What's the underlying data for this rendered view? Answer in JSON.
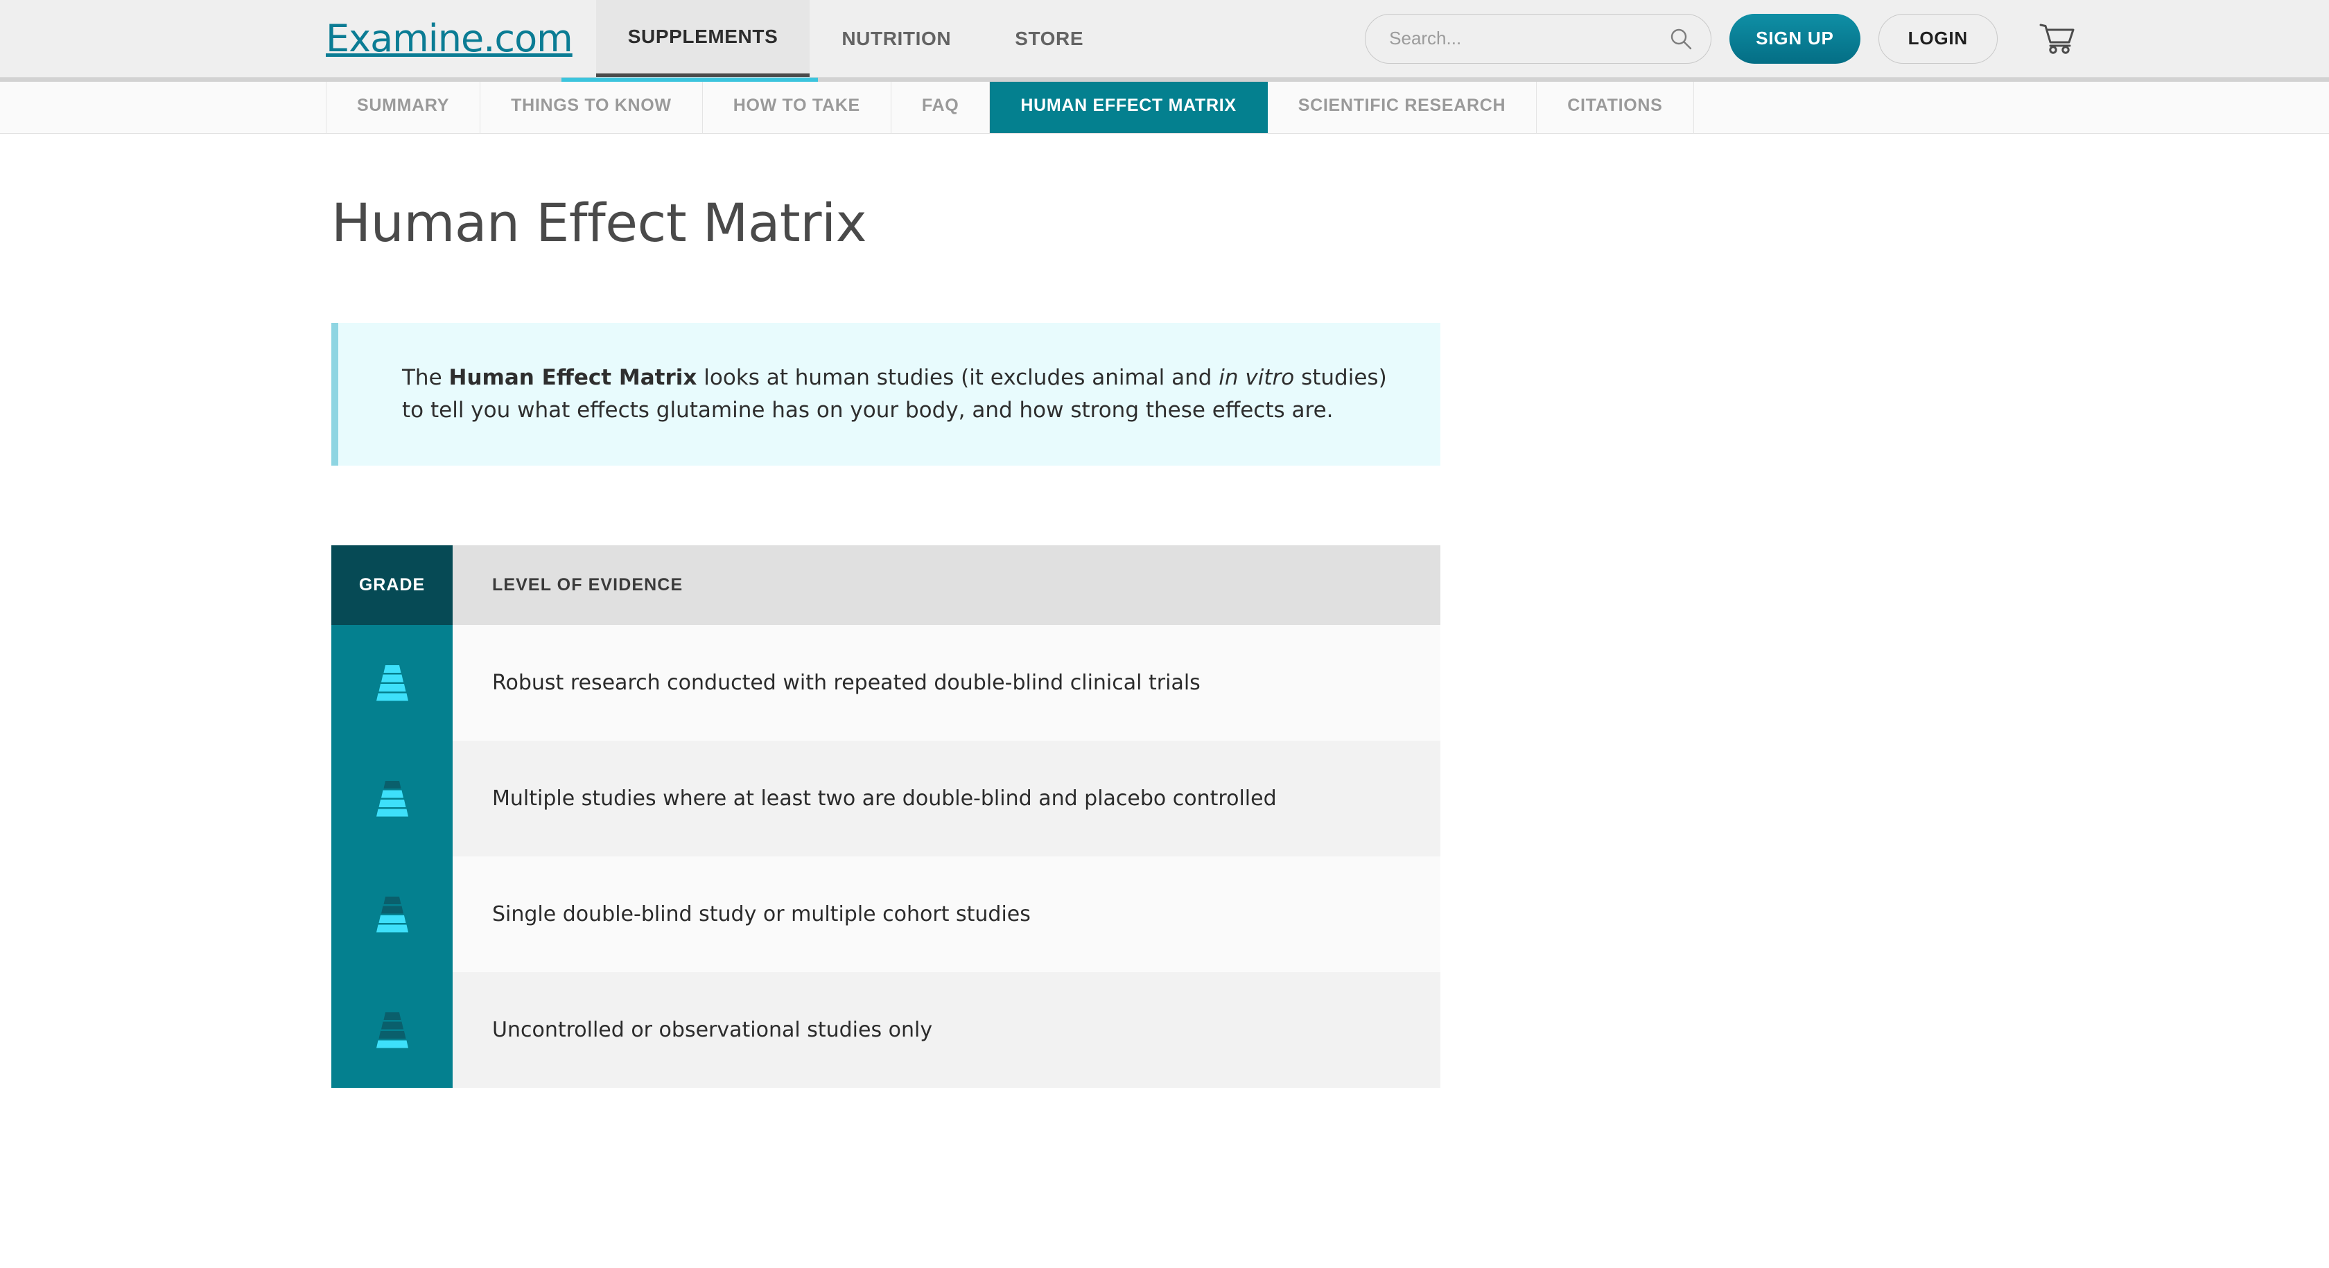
{
  "header": {
    "logo_text": "Examine.com",
    "nav": [
      {
        "label": "SUPPLEMENTS",
        "active": true
      },
      {
        "label": "NUTRITION",
        "active": false
      },
      {
        "label": "STORE",
        "active": false
      }
    ],
    "search": {
      "placeholder": "Search...",
      "value": "",
      "icon": "search-icon"
    },
    "signup_label": "SIGN UP",
    "login_label": "LOGIN",
    "cart_icon": "shopping-cart-icon",
    "accent_color": "#04808f"
  },
  "tabs": [
    {
      "label": "SUMMARY",
      "active": false
    },
    {
      "label": "THINGS TO KNOW",
      "active": false
    },
    {
      "label": "HOW TO TAKE",
      "active": false
    },
    {
      "label": "FAQ",
      "active": false
    },
    {
      "label": "HUMAN EFFECT MATRIX",
      "active": true
    },
    {
      "label": "SCIENTIFIC RESEARCH",
      "active": false
    },
    {
      "label": "CITATIONS",
      "active": false
    }
  ],
  "main": {
    "page_title": "Human Effect Matrix",
    "info_box": {
      "text_1": "The ",
      "bold_1": "Human Effect Matrix",
      "text_2": " looks at human studies (it excludes animal and ",
      "italic_1": "in vitro",
      "text_3": " studies) to tell you what effects glutamine has on your body, and how strong these effects are.",
      "background_color": "#e8fbfd",
      "border_color": "#8ed5e2"
    },
    "grade_table": {
      "columns": [
        "GRADE",
        "LEVEL OF EVIDENCE"
      ],
      "rows": [
        {
          "level": 4,
          "icon": "pyramid-grade-a-icon",
          "evidence": "Robust research conducted with repeated double-blind clinical trials"
        },
        {
          "level": 3,
          "icon": "pyramid-grade-b-icon",
          "evidence": "Multiple studies where at least two are double-blind and placebo controlled"
        },
        {
          "level": 2,
          "icon": "pyramid-grade-c-icon",
          "evidence": "Single double-blind study or multiple cohort studies"
        },
        {
          "level": 1,
          "icon": "pyramid-grade-d-icon",
          "evidence": "Uncontrolled or observational studies only"
        }
      ]
    }
  }
}
